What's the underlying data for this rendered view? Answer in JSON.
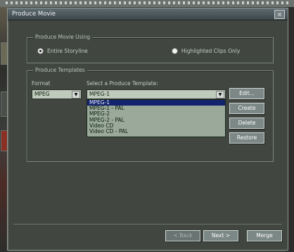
{
  "window": {
    "title": "Produce Movie",
    "close_glyph": "×"
  },
  "produce_using": {
    "legend": "Produce Movie Using",
    "options": [
      {
        "label": "Entire Storyline",
        "selected": true
      },
      {
        "label": "Highlighted Clips Only",
        "selected": false
      }
    ]
  },
  "templates": {
    "legend": "Produce Templates",
    "format_label": "Format",
    "format_value": "MPEG",
    "template_label": "Select a Produce Template:",
    "template_value": "MPEG-1",
    "list": [
      "MPEG-1",
      "MPEG-1 - PAL",
      "MPEG-2",
      "MPEG-2 - PAL",
      "Video CD",
      "Video CD - PAL"
    ],
    "selected_index": 0
  },
  "side_buttons": {
    "edit": "Edit...",
    "create": "Create",
    "delete": "Delete",
    "restore": "Restore"
  },
  "nav_buttons": {
    "back": "< Back",
    "next": "Next >",
    "merge": "Merge"
  },
  "icons": {
    "dropdown": "dropdown-arrow-icon",
    "close": "close-icon"
  },
  "colors": {
    "list_selection": "#13246f",
    "list_bg": "#9aa99a"
  }
}
